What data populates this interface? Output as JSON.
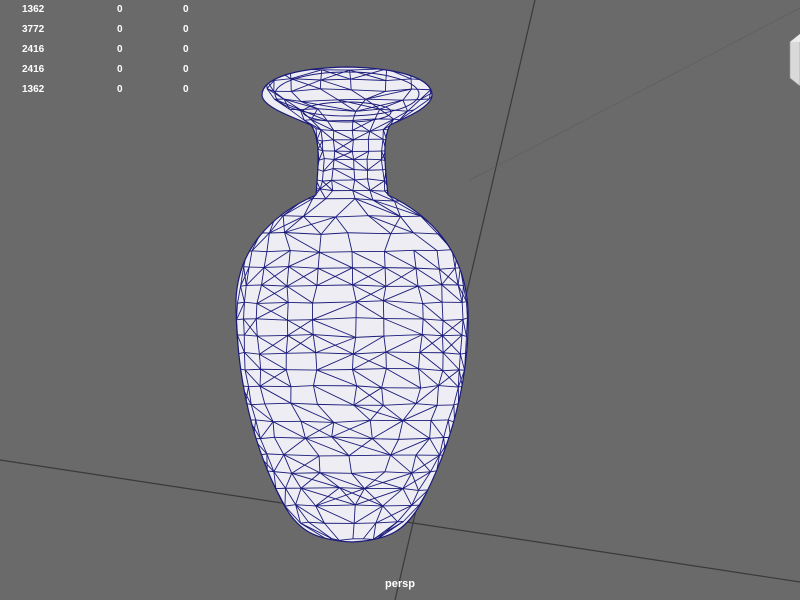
{
  "viewport": {
    "camera_label": "persp",
    "background_color": "#6a6a6a",
    "mesh_fill_color": "#ededf3",
    "wireframe_color": "#1a1a7a"
  },
  "hud": {
    "rows": [
      {
        "a": "1362",
        "b": "0",
        "c": "0"
      },
      {
        "a": "3772",
        "b": "0",
        "c": "0"
      },
      {
        "a": "2416",
        "b": "0",
        "c": "0"
      },
      {
        "a": "2416",
        "b": "0",
        "c": "0"
      },
      {
        "a": "1362",
        "b": "0",
        "c": "0"
      }
    ]
  },
  "icons": {
    "view_cube": "view-cube-icon"
  }
}
